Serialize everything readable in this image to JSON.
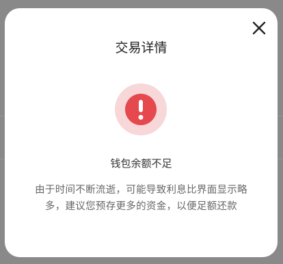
{
  "dialog": {
    "title": "交易详情",
    "close_icon": "close-icon",
    "status_icon": "exclamation-icon",
    "status_title": "钱包余额不足",
    "status_message": "由于时间不断流逝，可能导致利息比界面显示略多，建议您预存更多的资金，以便足额还款"
  },
  "colors": {
    "backdrop": "#898989",
    "dialog_background": "#ffffff",
    "error_red": "#e5484d",
    "error_halo": "#f8d7d8",
    "title_text": "#222222",
    "message_text": "#666666"
  }
}
